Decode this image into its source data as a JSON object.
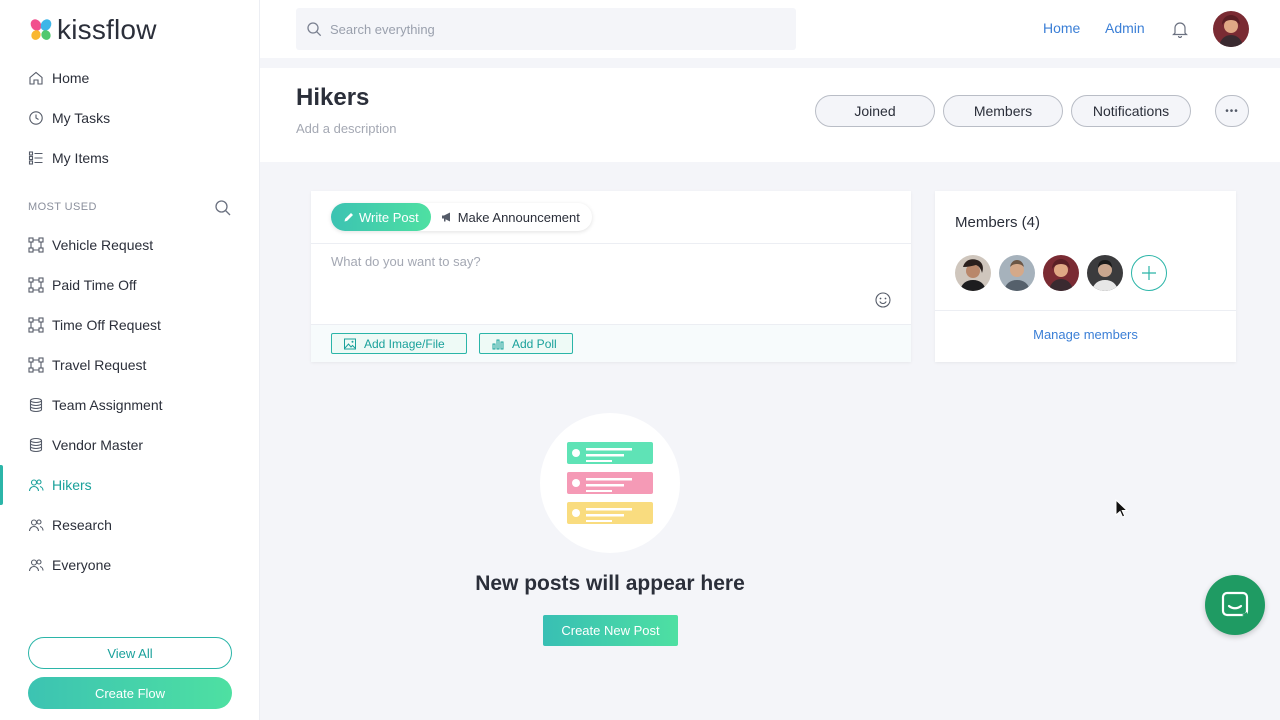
{
  "brand": {
    "name": "kissflow"
  },
  "sidebar": {
    "items_top": [
      {
        "label": "Home",
        "icon": "home-icon"
      },
      {
        "label": "My Tasks",
        "icon": "clock-icon"
      },
      {
        "label": "My Items",
        "icon": "list-icon"
      }
    ],
    "section_label": "MOST USED",
    "items": [
      {
        "label": "Vehicle Request",
        "icon": "flow-icon"
      },
      {
        "label": "Paid Time Off",
        "icon": "flow-icon"
      },
      {
        "label": "Time Off Request",
        "icon": "flow-icon"
      },
      {
        "label": "Travel Request",
        "icon": "flow-icon"
      },
      {
        "label": "Team Assignment",
        "icon": "database-icon"
      },
      {
        "label": "Vendor Master",
        "icon": "database-icon"
      },
      {
        "label": "Hikers",
        "icon": "people-icon",
        "active": true
      },
      {
        "label": "Research",
        "icon": "people-icon"
      },
      {
        "label": "Everyone",
        "icon": "people-icon"
      }
    ],
    "view_all": "View All",
    "create_flow": "Create Flow"
  },
  "topbar": {
    "search_placeholder": "Search everything",
    "links": [
      "Home",
      "Admin"
    ]
  },
  "header": {
    "title": "Hikers",
    "description": "Add a description",
    "buttons": [
      "Joined",
      "Members",
      "Notifications"
    ],
    "more_label": "•••"
  },
  "composer": {
    "tab_write": "Write Post",
    "tab_announce": "Make Announcement",
    "placeholder": "What do you want to say?",
    "attach_file": "Add Image/File",
    "attach_poll": "Add Poll"
  },
  "members": {
    "title": "Members (4)",
    "manage": "Manage members"
  },
  "empty_state": {
    "title": "New posts will appear here",
    "button": "Create New Post"
  },
  "colors": {
    "accent": "#2bb5a8",
    "link": "#3b7fd6",
    "chat": "#1f9b63",
    "card_green": "#5fe3b6",
    "card_pink": "#f59ab6",
    "card_yellow": "#f9dc7f"
  }
}
